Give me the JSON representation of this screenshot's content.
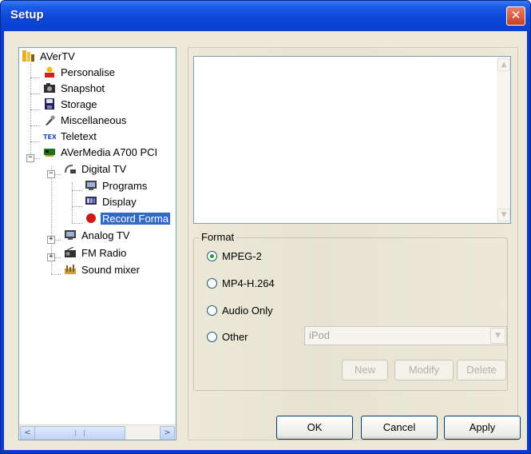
{
  "window": {
    "title": "Setup",
    "close_glyph": "✕"
  },
  "tree": {
    "items": [
      {
        "label": "AVerTV",
        "icon": "avertv-icon"
      },
      {
        "label": "Personalise",
        "icon": "personalise-icon"
      },
      {
        "label": "Snapshot",
        "icon": "camera-icon"
      },
      {
        "label": "Storage",
        "icon": "floppy-icon"
      },
      {
        "label": "Miscellaneous",
        "icon": "wrench-icon"
      },
      {
        "label": "Teletext",
        "icon": "text-icon"
      },
      {
        "label": "AVerMedia A700 PCI",
        "icon": "card-icon"
      },
      {
        "label": "Digital TV",
        "icon": "satellite-icon"
      },
      {
        "label": "Programs",
        "icon": "tv-icon"
      },
      {
        "label": "Display",
        "icon": "monitor-icon"
      },
      {
        "label": "Record Forma",
        "icon": "record-icon"
      },
      {
        "label": "Analog TV",
        "icon": "tv-icon"
      },
      {
        "label": "FM Radio",
        "icon": "radio-icon"
      },
      {
        "label": "Sound mixer",
        "icon": "mixer-icon"
      }
    ],
    "expanders": {
      "minus": "−",
      "plus": "+"
    },
    "scroll": {
      "left": "<",
      "right": ">"
    }
  },
  "format": {
    "group_title": "Format",
    "options": [
      {
        "label": "MPEG-2",
        "checked": true
      },
      {
        "label": "MP4-H.264",
        "checked": false
      },
      {
        "label": "Audio Only",
        "checked": false
      },
      {
        "label": "Other",
        "checked": false
      }
    ],
    "other_value": "iPod",
    "buttons": {
      "new": "New",
      "modify": "Modify",
      "delete": "Delete"
    }
  },
  "footer": {
    "ok": "OK",
    "cancel": "Cancel",
    "apply": "Apply"
  },
  "colors": {
    "title_bar": "#0a46d8",
    "selection": "#316ac5",
    "radio_dot": "#21a121"
  }
}
